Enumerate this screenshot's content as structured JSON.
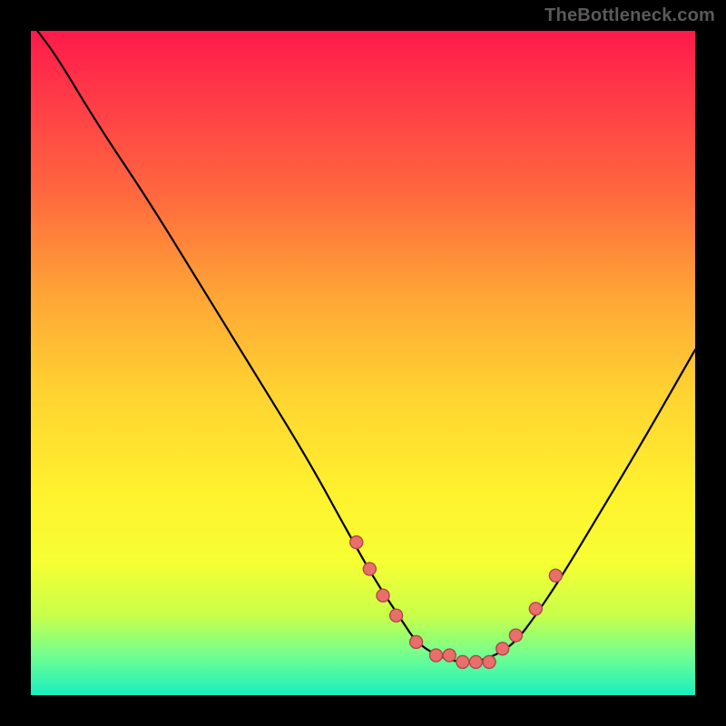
{
  "watermark": "TheBottleneck.com",
  "colors": {
    "dot_fill": "#e96f6d",
    "dot_stroke": "#b24746",
    "curve_stroke": "#000000",
    "gradient_top": "#ff1a4a",
    "gradient_mid": "#fff22e",
    "gradient_bottom": "#18eec0"
  },
  "chart_data": {
    "type": "line",
    "title": "",
    "xlabel": "",
    "ylabel": "",
    "xlim": [
      0,
      100
    ],
    "ylim": [
      0,
      100
    ],
    "series": [
      {
        "name": "bottleneck-curve",
        "x": [
          1,
          4,
          10,
          18,
          26,
          34,
          42,
          48,
          52,
          56,
          58,
          61,
          64,
          67,
          70,
          73,
          76,
          80,
          86,
          92,
          100
        ],
        "values": [
          100,
          96,
          86,
          74,
          61,
          48,
          35,
          24,
          17,
          11,
          8,
          6,
          5,
          5,
          6,
          8,
          12,
          18,
          28,
          38,
          52
        ]
      }
    ],
    "markers": {
      "name": "highlighted-points",
      "x": [
        49,
        51,
        53,
        55,
        58,
        61,
        63,
        65,
        67,
        69,
        71,
        73,
        76,
        79
      ],
      "values": [
        23,
        19,
        15,
        12,
        8,
        6,
        6,
        5,
        5,
        5,
        7,
        9,
        13,
        18
      ]
    }
  }
}
